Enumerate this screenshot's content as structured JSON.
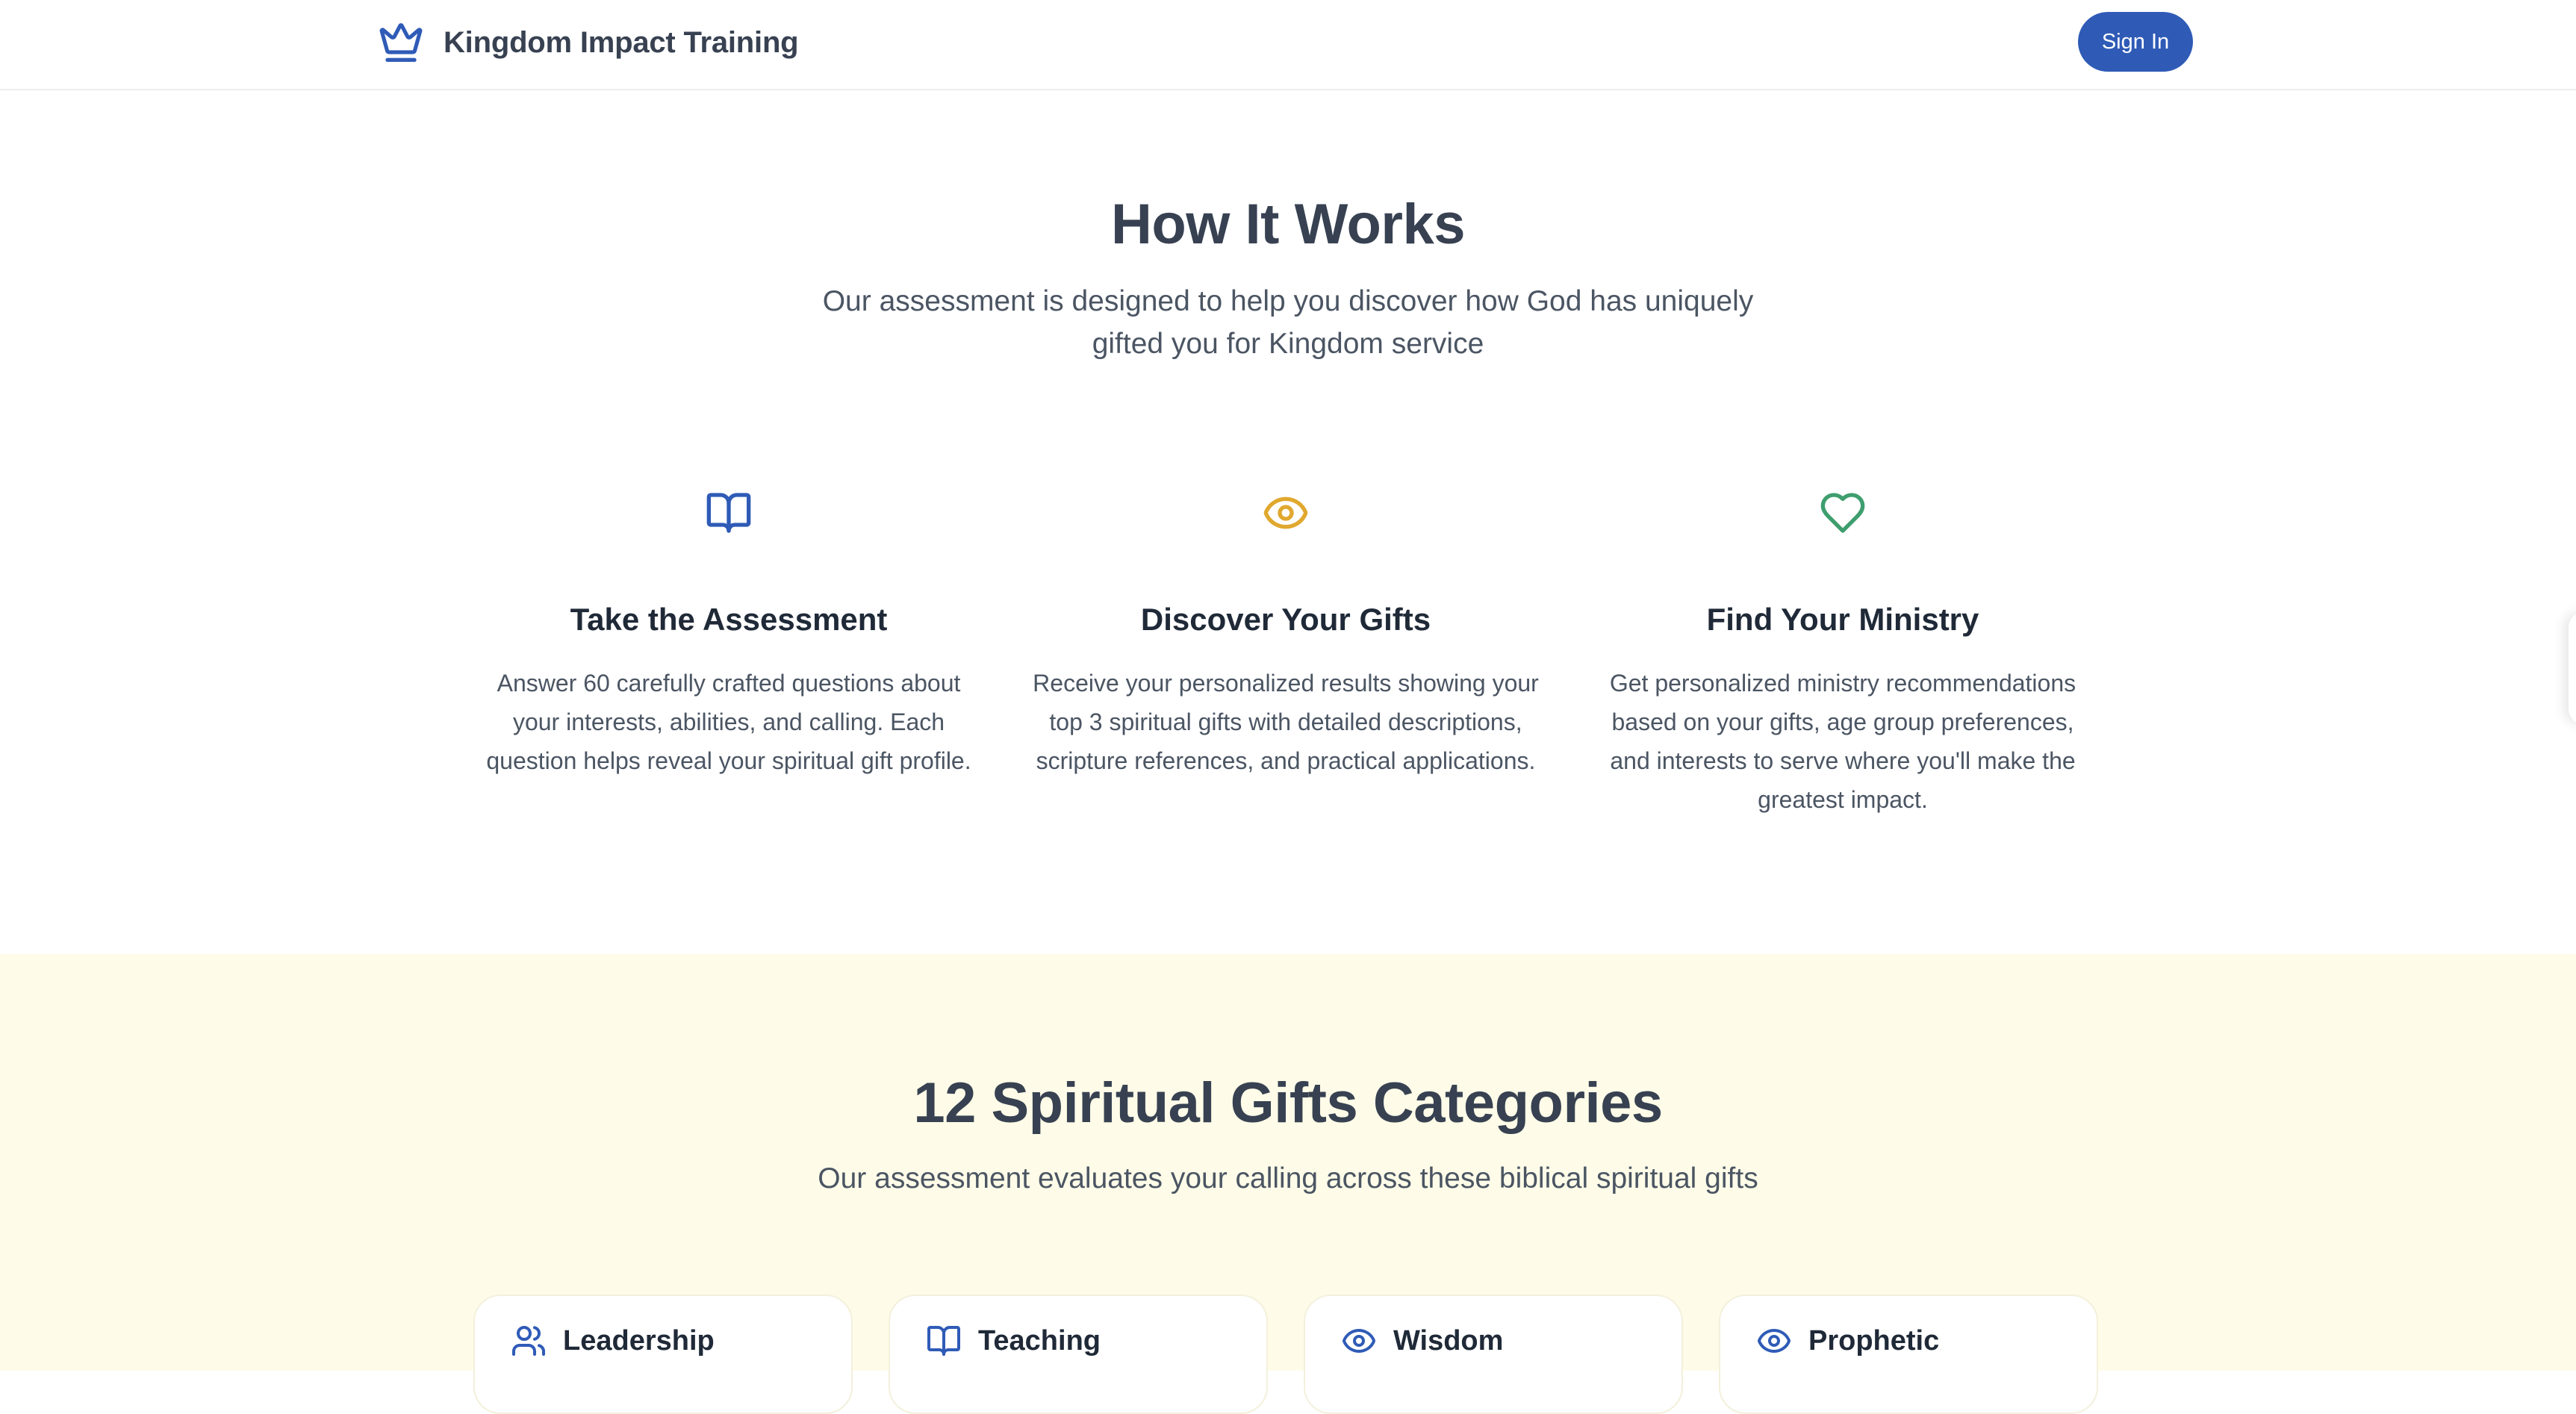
{
  "header": {
    "brand_name": "Kingdom Impact Training",
    "brand_icon": "crown-icon",
    "signin_label": "Sign In"
  },
  "how_it_works": {
    "title": "How It Works",
    "subtitle": "Our assessment is designed to help you discover how God has uniquely gifted you for Kingdom service",
    "steps": [
      {
        "icon": "book-open-icon",
        "icon_color": "#2f5bb7",
        "title": "Take the Assessment",
        "text": "Answer 60 carefully crafted questions about your interests, abilities, and calling. Each question helps reveal your spiritual gift profile."
      },
      {
        "icon": "eye-icon",
        "icon_color": "#e0a82e",
        "title": "Discover Your Gifts",
        "text": "Receive your personalized results showing your top 3 spiritual gifts with detailed descriptions, scripture references, and practical applications."
      },
      {
        "icon": "heart-icon",
        "icon_color": "#3e9e6e",
        "title": "Find Your Ministry",
        "text": "Get personalized ministry recommendations based on your gifts, age group preferences, and interests to serve where you'll make the greatest impact."
      }
    ]
  },
  "gifts": {
    "title": "12 Spiritual Gifts Categories",
    "subtitle": "Our assessment evaluates your calling across these biblical spiritual gifts",
    "cards": [
      {
        "icon": "users-icon",
        "name": "Leadership"
      },
      {
        "icon": "book-open-icon",
        "name": "Teaching"
      },
      {
        "icon": "eye-icon",
        "name": "Wisdom"
      },
      {
        "icon": "eye-icon",
        "name": "Prophetic"
      }
    ]
  },
  "colors": {
    "brand_blue": "#2f5bb7",
    "gold": "#e0a82e",
    "green": "#3e9e6e",
    "gifts_background": "#fefce8"
  }
}
